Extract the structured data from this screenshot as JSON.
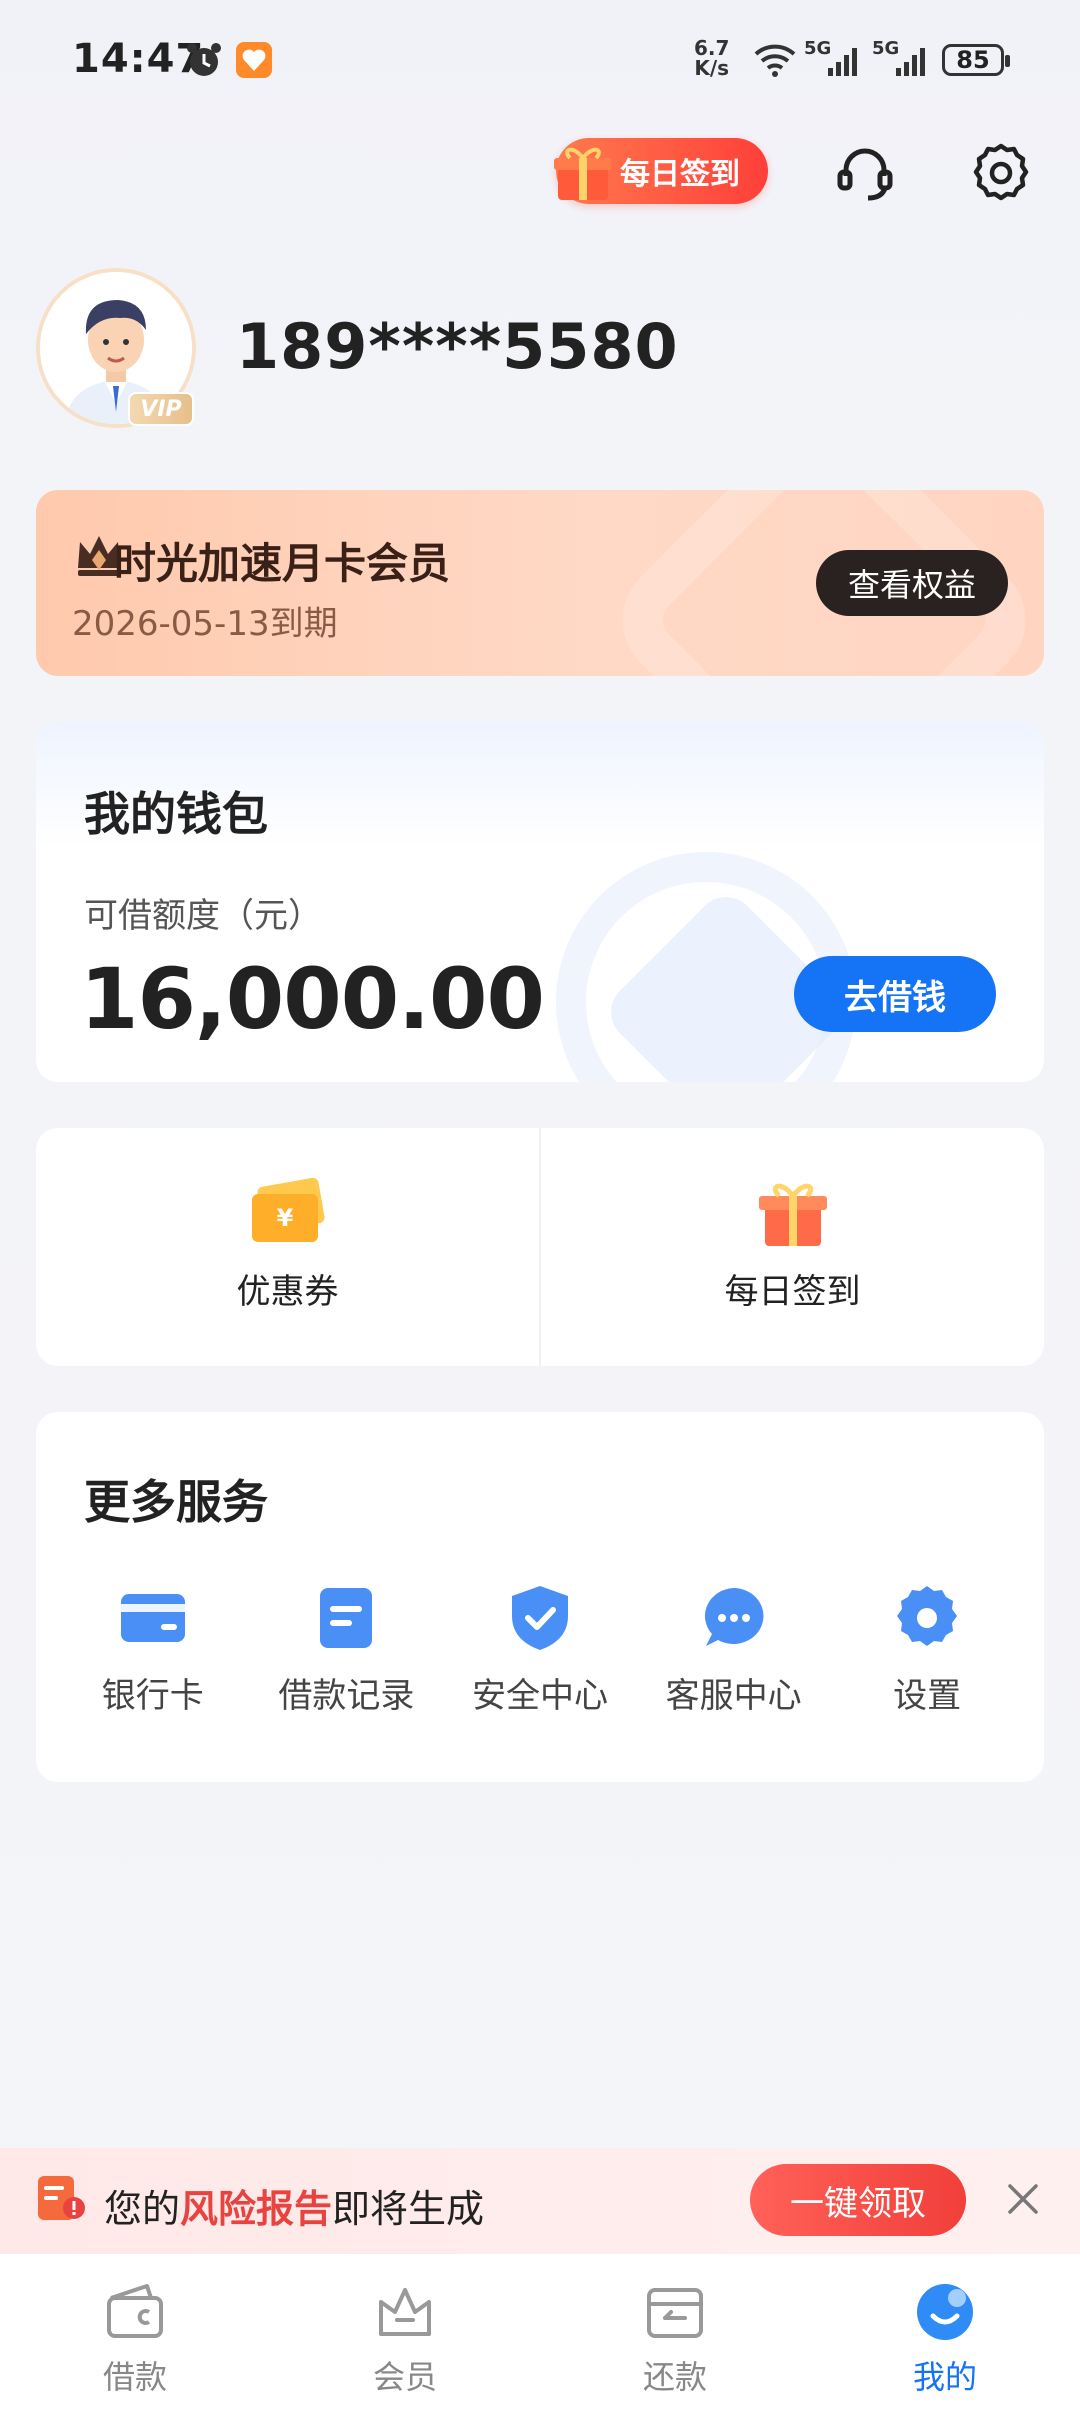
{
  "status_bar": {
    "time": "14:47",
    "net_speed_top": "6.7",
    "net_speed_bottom": "K/s",
    "signal_1": "5G",
    "signal_2": "5G",
    "battery": "85"
  },
  "header": {
    "checkin_label": "每日签到"
  },
  "profile": {
    "phone": "189****5580",
    "vip_badge": "VIP"
  },
  "membership": {
    "title": "时光加速月卡会员",
    "expiry": "2026-05-13到期",
    "rights_button": "查看权益"
  },
  "wallet": {
    "title": "我的钱包",
    "quota_label": "可借额度（元）",
    "quota_value": "16,000.00",
    "borrow_button": "去借钱"
  },
  "quick_tiles": [
    {
      "label": "优惠券",
      "icon": "coupon-icon"
    },
    {
      "label": "每日签到",
      "icon": "gift-icon"
    }
  ],
  "more_services": {
    "title": "更多服务",
    "items": [
      {
        "label": "银行卡",
        "icon": "bank-card-icon"
      },
      {
        "label": "借款记录",
        "icon": "record-icon"
      },
      {
        "label": "安全中心",
        "icon": "shield-icon"
      },
      {
        "label": "客服中心",
        "icon": "chat-icon"
      },
      {
        "label": "设置",
        "icon": "gear-icon"
      }
    ]
  },
  "risk_banner": {
    "prefix": "您的",
    "highlight": "风险报告",
    "suffix": "即将生成",
    "button": "一键领取"
  },
  "tabbar": {
    "items": [
      {
        "label": "借款",
        "icon": "wallet-icon"
      },
      {
        "label": "会员",
        "icon": "crown-icon"
      },
      {
        "label": "还款",
        "icon": "repay-icon"
      },
      {
        "label": "我的",
        "icon": "profile-icon"
      }
    ],
    "active_index": 3
  },
  "colors": {
    "accent_blue": "#1573f5",
    "risk_red": "#e8433f",
    "member_bg": "#ffd2bd"
  }
}
